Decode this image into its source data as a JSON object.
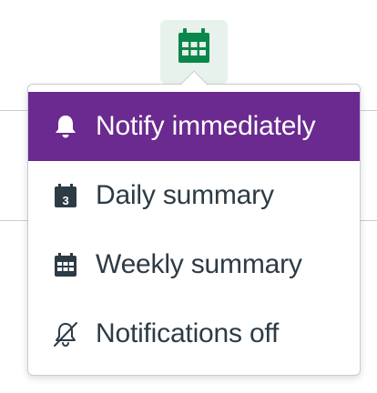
{
  "colors": {
    "accent": "#6b2a8f",
    "trigger_icon": "#0b874b",
    "trigger_bg": "#e8f2ec",
    "text": "#2d3b45"
  },
  "trigger": {
    "icon": "calendar-icon"
  },
  "menu": {
    "items": [
      {
        "label": "Notify immediately",
        "icon": "bell-icon",
        "selected": true
      },
      {
        "label": "Daily summary",
        "icon": "calendar-day-icon",
        "icon_text": "3",
        "selected": false
      },
      {
        "label": "Weekly summary",
        "icon": "calendar-week-icon",
        "selected": false
      },
      {
        "label": "Notifications off",
        "icon": "bell-off-icon",
        "selected": false
      }
    ]
  }
}
